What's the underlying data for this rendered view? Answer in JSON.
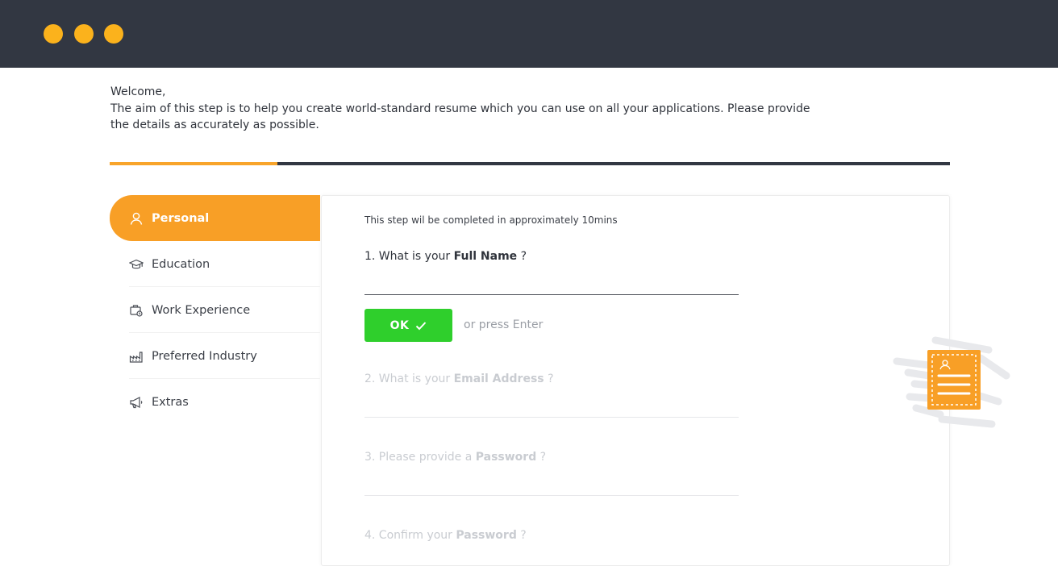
{
  "window": {
    "dots": [
      "yellow-dot",
      "yellow-dot",
      "yellow-dot"
    ],
    "dot_color": "#fbb21c",
    "titlebar_color": "#323742"
  },
  "intro": {
    "greeting": "Welcome,",
    "line1": "The aim of this step is to help you create world-standard resume which you can use on all your applications. Please provide",
    "line2": "the details as accurately as possible."
  },
  "progress": {
    "fraction": 0.2,
    "fill_color": "#f8a42a",
    "track_color": "#323742"
  },
  "sidebar": {
    "items": [
      {
        "label": "Personal",
        "icon": "user-icon",
        "active": true
      },
      {
        "label": "Education",
        "icon": "graduation-cap-icon",
        "active": false
      },
      {
        "label": "Work Experience",
        "icon": "briefcase-icon",
        "active": false
      },
      {
        "label": "Preferred Industry",
        "icon": "factory-icon",
        "active": false
      },
      {
        "label": "Extras",
        "icon": "megaphone-icon",
        "active": false
      }
    ],
    "active_color": "#f89f26"
  },
  "form": {
    "step_note": "This step wil be completed in approximately 10mins",
    "questions": [
      {
        "prefix": "1. What is your ",
        "bold": "Full Name",
        "suffix": " ?",
        "value": "",
        "active": true
      },
      {
        "prefix": "2. What is your ",
        "bold": "Email Address",
        "suffix": " ?",
        "value": "",
        "active": false
      },
      {
        "prefix": "3. Please provide a ",
        "bold": "Password",
        "suffix": " ?",
        "value": "",
        "active": false
      },
      {
        "prefix": "4. Confirm your ",
        "bold": "Password",
        "suffix": " ?",
        "value": "",
        "active": false
      }
    ],
    "ok_label": "OK",
    "ok_icon": "check-icon",
    "ok_color": "#2fcf2c",
    "press_hint": "or press Enter"
  },
  "decoration": {
    "icon": "resume-document-icon",
    "color": "#f89f26"
  }
}
